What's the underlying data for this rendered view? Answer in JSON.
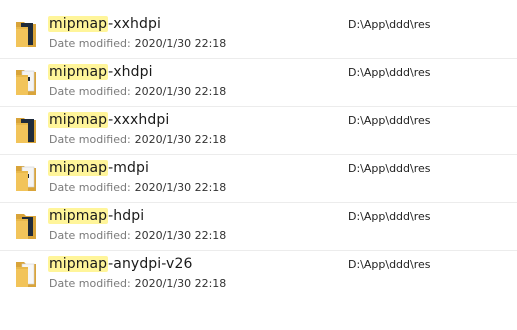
{
  "search_highlight": "mipmap",
  "date_modified_label": "Date modified:",
  "items": [
    {
      "highlight": "mipmap",
      "suffix": "-xxhdpi",
      "date": "2020/1/30 22:18",
      "path": "D:\\App\\ddd\\res",
      "icon": "folder-dark-doc-icon"
    },
    {
      "highlight": "mipmap",
      "suffix": "-xhdpi",
      "date": "2020/1/30 22:18",
      "path": "D:\\App\\ddd\\res",
      "icon": "folder-image-icon"
    },
    {
      "highlight": "mipmap",
      "suffix": "-xxxhdpi",
      "date": "2020/1/30 22:18",
      "path": "D:\\App\\ddd\\res",
      "icon": "folder-dark-doc-icon"
    },
    {
      "highlight": "mipmap",
      "suffix": "-mdpi",
      "date": "2020/1/30 22:18",
      "path": "D:\\App\\ddd\\res",
      "icon": "folder-image-icon"
    },
    {
      "highlight": "mipmap",
      "suffix": "-hdpi",
      "date": "2020/1/30 22:18",
      "path": "D:\\App\\ddd\\res",
      "icon": "folder-dark-doc-icon"
    },
    {
      "highlight": "mipmap",
      "suffix": "-anydpi-v26",
      "date": "2020/1/30 22:18",
      "path": "D:\\App\\ddd\\res",
      "icon": "folder-plain-icon"
    }
  ],
  "colors": {
    "highlight": "#fff59a",
    "folder": "#e8b84a",
    "folder_back": "#d9a43a",
    "doc_dark": "#1f2b3a"
  }
}
